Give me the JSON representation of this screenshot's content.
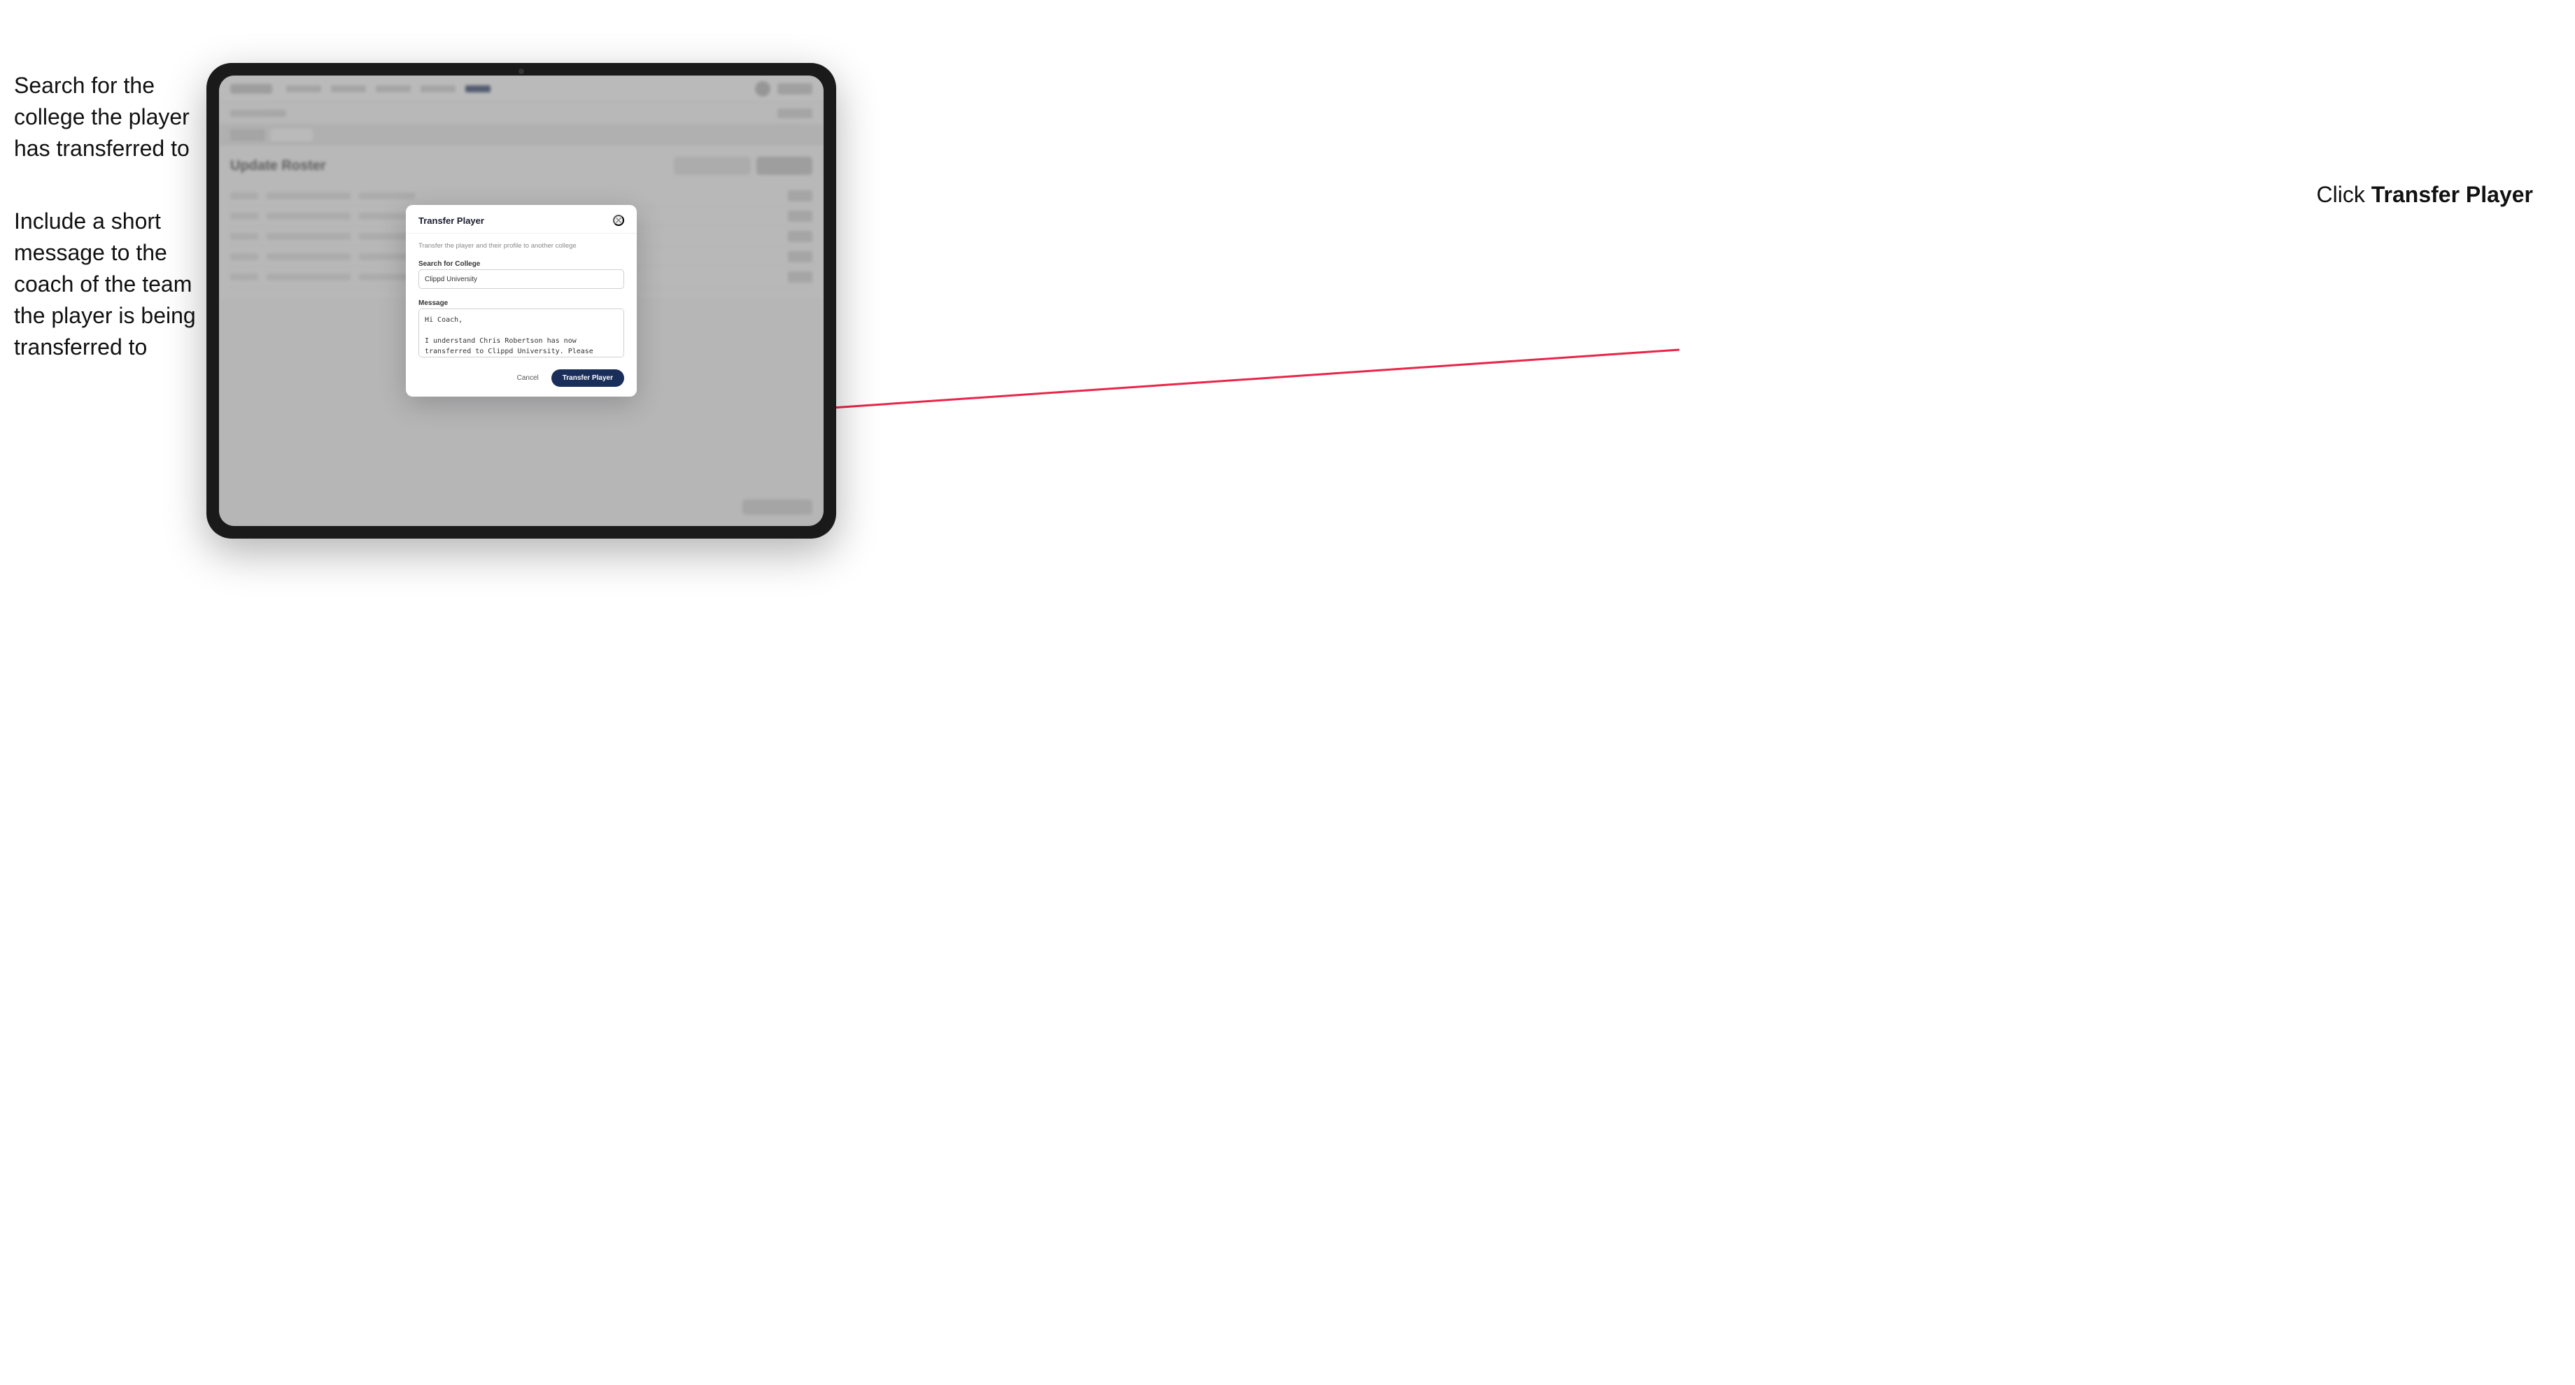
{
  "annotations": {
    "left": {
      "line1": "Search for the college the player has transferred to",
      "line2": "Include a short message to the coach of the team the player is being transferred to"
    },
    "right": {
      "prefix": "Click ",
      "bold": "Transfer Player"
    }
  },
  "tablet": {
    "nav": {
      "logo": "",
      "links": [
        "Communities",
        "Tools",
        "Scouting",
        "Store",
        "Roster"
      ],
      "activeLink": "Roster"
    },
    "subheader": {
      "breadcrumb": "Enrolled (11)",
      "action": "Create +"
    },
    "tabs": {
      "items": [
        "List",
        "Board"
      ],
      "active": "Board"
    },
    "page": {
      "title": "Update Roster",
      "buttons": [
        "+ Add Existing Player",
        "+ Add Player"
      ]
    },
    "roster": {
      "columns": [
        "Name",
        "Position",
        "Jersey",
        "Status"
      ],
      "rows": [
        [
          "Name Placeholder",
          "POS",
          "00",
          "Active"
        ],
        [
          "Chris Robertson",
          "FWD",
          "10",
          "Transfer"
        ],
        [
          "Player Name",
          "MID",
          "07",
          "Active"
        ],
        [
          "Player Name",
          "DEF",
          "04",
          "Active"
        ],
        [
          "Player Name",
          "GK",
          "01",
          "Active"
        ]
      ]
    },
    "footer": {
      "button": "Save Changes"
    }
  },
  "modal": {
    "title": "Transfer Player",
    "description": "Transfer the player and their profile to another college",
    "fields": {
      "college": {
        "label": "Search for College",
        "value": "Clippd University"
      },
      "message": {
        "label": "Message",
        "value": "Hi Coach,\n\nI understand Chris Robertson has now transferred to Clippd University. Please accept this transfer request when you can."
      }
    },
    "buttons": {
      "cancel": "Cancel",
      "confirm": "Transfer Player"
    }
  }
}
